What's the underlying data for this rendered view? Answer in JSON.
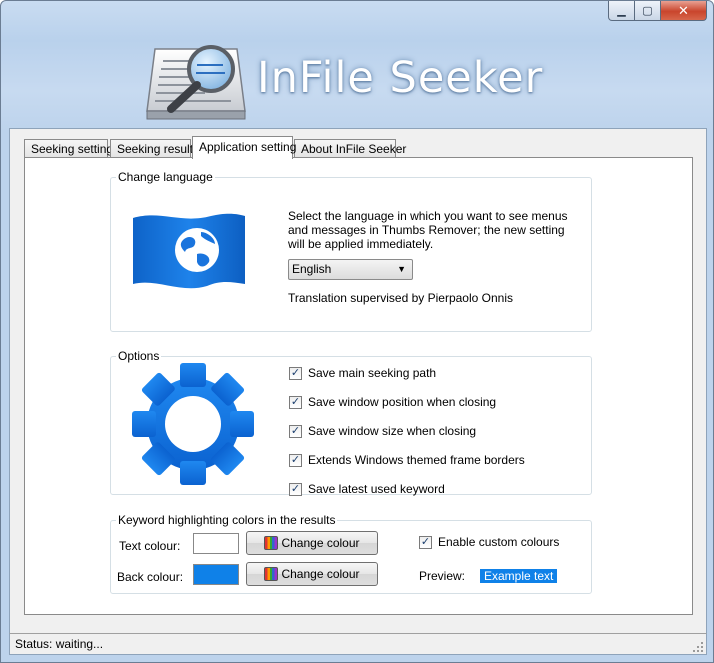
{
  "window": {
    "title": "InFile Seeker",
    "controls": {
      "minimize": "▁",
      "maximize": "▢",
      "close": "✕"
    }
  },
  "tabs": [
    {
      "label": "Seeking setting"
    },
    {
      "label": "Seeking results"
    },
    {
      "label": "Application setting",
      "active": true
    },
    {
      "label": "About InFile Seeker"
    }
  ],
  "language": {
    "legend": "Change language",
    "description": "Select the language in which you want to see menus and messages in Thumbs Remover; the new setting will be applied immediately.",
    "selected": "English",
    "translation_note": "Translation supervised by Pierpaolo Onnis",
    "icon": "globe-flag-icon"
  },
  "options": {
    "legend": "Options",
    "icon": "gear-icon",
    "items": [
      {
        "label": "Save main seeking path",
        "checked": true
      },
      {
        "label": "Save window position when closing",
        "checked": true
      },
      {
        "label": "Save window size when closing",
        "checked": true
      },
      {
        "label": "Extends Windows themed frame borders",
        "checked": true
      },
      {
        "label": "Save latest used keyword",
        "checked": true
      }
    ]
  },
  "colors": {
    "legend": "Keyword highlighting colors in the results",
    "text_label": "Text colour:",
    "back_label": "Back colour:",
    "change_label": "Change colour",
    "custom_label": "Enable custom colours",
    "custom_checked": true,
    "preview_label": "Preview:",
    "example_text": "Example text",
    "text_colour_value": "#ffffff",
    "back_colour_value": "#0f81e8"
  },
  "status": {
    "text": "Status: waiting..."
  }
}
